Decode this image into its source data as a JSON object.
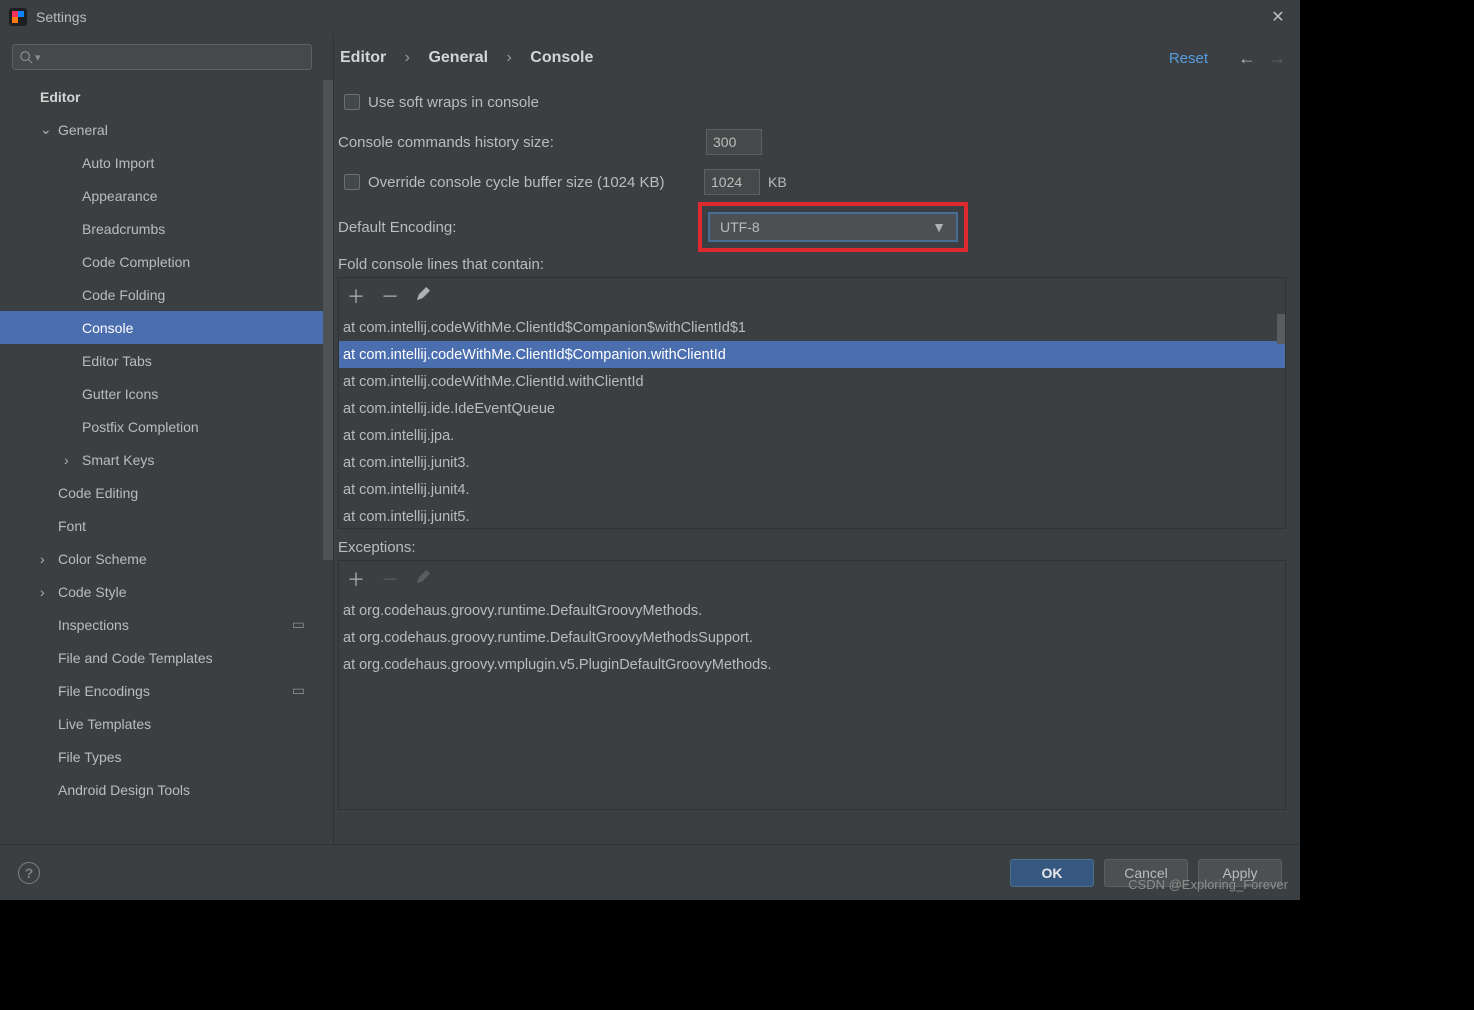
{
  "window": {
    "title": "Settings"
  },
  "breadcrumb": {
    "a": "Editor",
    "b": "General",
    "c": "Console"
  },
  "toolbar": {
    "reset": "Reset"
  },
  "sidebar": {
    "items": [
      {
        "label": "Editor",
        "level": 0,
        "bold": true,
        "arrow": "",
        "sub": false
      },
      {
        "label": "General",
        "level": 1,
        "bold": false,
        "arrow": "down",
        "sub": false
      },
      {
        "label": "Auto Import",
        "level": 2,
        "bold": false,
        "arrow": "",
        "sub": false
      },
      {
        "label": "Appearance",
        "level": 2,
        "bold": false,
        "arrow": "",
        "sub": false
      },
      {
        "label": "Breadcrumbs",
        "level": 2,
        "bold": false,
        "arrow": "",
        "sub": false
      },
      {
        "label": "Code Completion",
        "level": 2,
        "bold": false,
        "arrow": "",
        "sub": false
      },
      {
        "label": "Code Folding",
        "level": 2,
        "bold": false,
        "arrow": "",
        "sub": false
      },
      {
        "label": "Console",
        "level": 2,
        "bold": false,
        "arrow": "",
        "sub": false,
        "selected": true
      },
      {
        "label": "Editor Tabs",
        "level": 2,
        "bold": false,
        "arrow": "",
        "sub": false
      },
      {
        "label": "Gutter Icons",
        "level": 2,
        "bold": false,
        "arrow": "",
        "sub": false
      },
      {
        "label": "Postfix Completion",
        "level": 2,
        "bold": false,
        "arrow": "",
        "sub": false
      },
      {
        "label": "Smart Keys",
        "level": 2,
        "bold": false,
        "arrow": "right",
        "sub": true
      },
      {
        "label": "Code Editing",
        "level": 1,
        "bold": false,
        "arrow": "",
        "sub": false
      },
      {
        "label": "Font",
        "level": 1,
        "bold": false,
        "arrow": "",
        "sub": false
      },
      {
        "label": "Color Scheme",
        "level": 1,
        "bold": false,
        "arrow": "right",
        "sub": true
      },
      {
        "label": "Code Style",
        "level": 1,
        "bold": false,
        "arrow": "right",
        "sub": true
      },
      {
        "label": "Inspections",
        "level": 1,
        "bold": false,
        "arrow": "",
        "sub": false,
        "badge": true
      },
      {
        "label": "File and Code Templates",
        "level": 1,
        "bold": false,
        "arrow": "",
        "sub": false
      },
      {
        "label": "File Encodings",
        "level": 1,
        "bold": false,
        "arrow": "",
        "sub": false,
        "badge": true
      },
      {
        "label": "Live Templates",
        "level": 1,
        "bold": false,
        "arrow": "",
        "sub": false
      },
      {
        "label": "File Types",
        "level": 1,
        "bold": false,
        "arrow": "",
        "sub": false
      },
      {
        "label": "Android Design Tools",
        "level": 1,
        "bold": false,
        "arrow": "",
        "sub": false
      }
    ]
  },
  "form": {
    "soft_wraps_label": "Use soft wraps in console",
    "history_label": "Console commands history size:",
    "history_value": "300",
    "override_label": "Override console cycle buffer size (1024 KB)",
    "override_value": "1024",
    "kb": "KB",
    "encoding_label": "Default Encoding:",
    "encoding_value": "UTF-8",
    "fold_label": "Fold console lines that contain:",
    "exceptions_label": "Exceptions:"
  },
  "fold_lines": [
    "at com.intellij.codeWithMe.ClientId$Companion$withClientId$1",
    "at com.intellij.codeWithMe.ClientId$Companion.withClientId",
    "at com.intellij.codeWithMe.ClientId.withClientId",
    "at com.intellij.ide.IdeEventQueue",
    "at com.intellij.jpa.",
    "at com.intellij.junit3.",
    "at com.intellij.junit4.",
    "at com.intellij.junit5."
  ],
  "fold_selected_index": 1,
  "exception_lines": [
    "at org.codehaus.groovy.runtime.DefaultGroovyMethods.",
    "at org.codehaus.groovy.runtime.DefaultGroovyMethodsSupport.",
    "at org.codehaus.groovy.vmplugin.v5.PluginDefaultGroovyMethods."
  ],
  "footer": {
    "ok": "OK",
    "cancel": "Cancel",
    "apply": "Apply"
  },
  "watermark": "CSDN @Exploring_Forever"
}
